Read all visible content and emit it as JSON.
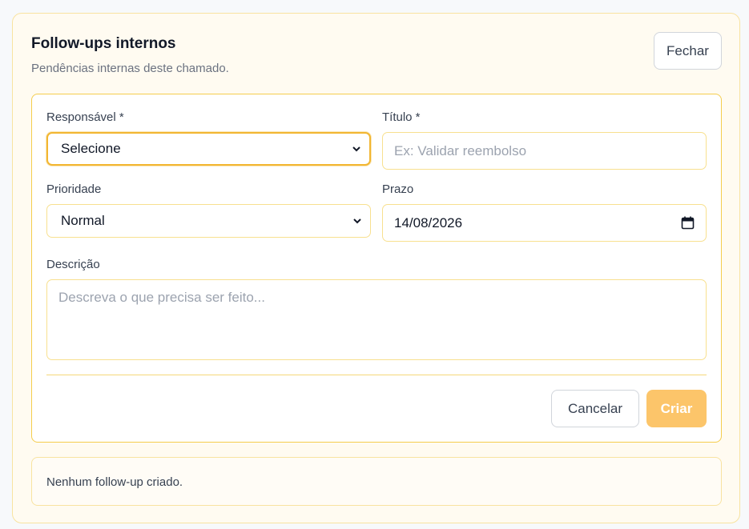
{
  "header": {
    "title": "Follow-ups internos",
    "subtitle": "Pendências internas deste chamado.",
    "close_label": "Fechar"
  },
  "form": {
    "responsavel": {
      "label": "Responsável *",
      "value": "Selecione"
    },
    "titulo": {
      "label": "Título *",
      "placeholder": "Ex: Validar reembolso",
      "value": ""
    },
    "prioridade": {
      "label": "Prioridade",
      "value": "Normal"
    },
    "prazo": {
      "label": "Prazo",
      "value": "14/08/2026"
    },
    "descricao": {
      "label": "Descrição",
      "placeholder": "Descreva o que precisa ser feito...",
      "value": ""
    },
    "cancel_label": "Cancelar",
    "create_label": "Criar"
  },
  "followups": {
    "empty_text": "Nenhum follow-up criado."
  },
  "colors": {
    "accent": "#f2b631",
    "accent_disabled": "#fcc56a",
    "panel_bg": "#fffbf1",
    "border": "#f8e3a0"
  },
  "icons": {
    "select_chevron": "chevron-down-icon",
    "date_picker": "calendar-icon"
  }
}
